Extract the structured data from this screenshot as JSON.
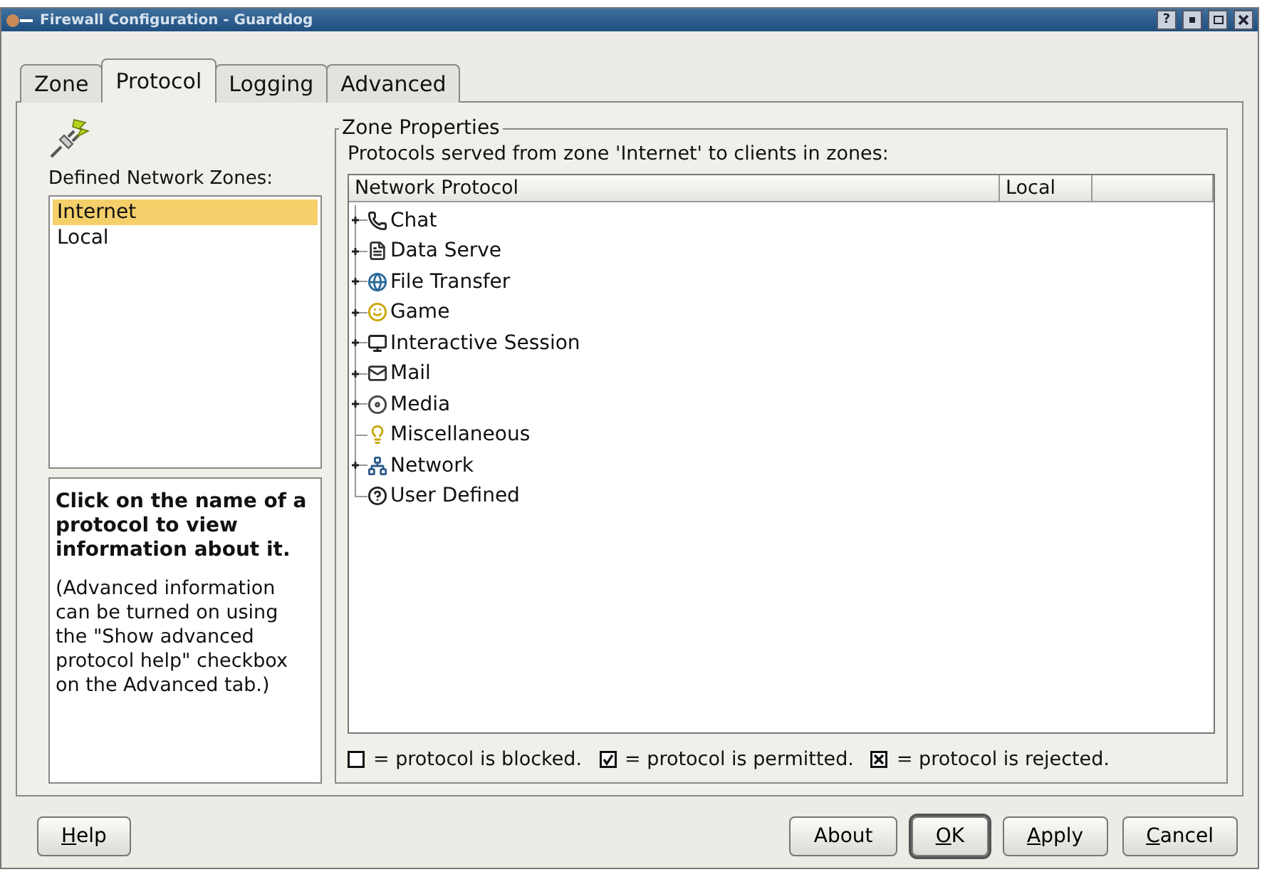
{
  "window": {
    "title": "Firewall Configuration - Guarddog",
    "help_glyph": "?"
  },
  "tabs": [
    {
      "label": "Zone",
      "selected": false
    },
    {
      "label": "Protocol",
      "selected": true
    },
    {
      "label": "Logging",
      "selected": false
    },
    {
      "label": "Advanced",
      "selected": false
    }
  ],
  "zones": {
    "label": "Defined Network Zones:",
    "items": [
      {
        "label": "Internet",
        "selected": true
      },
      {
        "label": "Local",
        "selected": false
      }
    ]
  },
  "help": {
    "heading": "Click on the name of a protocol to view information about it.",
    "body": "(Advanced information can be turned on using the \"Show advanced protocol help\" checkbox on the Advanced tab.)"
  },
  "zone_properties": {
    "title": "Zone Properties",
    "caption": "Protocols served from zone 'Internet' to clients in zones:",
    "columns": [
      "Network Protocol",
      "Local"
    ],
    "protocols": [
      {
        "label": "Chat",
        "expandable": true
      },
      {
        "label": "Data Serve",
        "expandable": true
      },
      {
        "label": "File Transfer",
        "expandable": true
      },
      {
        "label": "Game",
        "expandable": true
      },
      {
        "label": "Interactive Session",
        "expandable": true
      },
      {
        "label": "Mail",
        "expandable": true
      },
      {
        "label": "Media",
        "expandable": true
      },
      {
        "label": "Miscellaneous",
        "expandable": false
      },
      {
        "label": "Network",
        "expandable": true
      },
      {
        "label": "User Defined",
        "expandable": false
      }
    ],
    "legend": [
      {
        "kind": "blocked",
        "text": "= protocol is blocked."
      },
      {
        "kind": "permitted",
        "text": "= protocol is permitted."
      },
      {
        "kind": "rejected",
        "text": "= protocol is rejected."
      }
    ]
  },
  "buttons": [
    {
      "label": "Help",
      "mnemonic": true,
      "default": false
    },
    {
      "label": "About",
      "mnemonic": false,
      "default": false
    },
    {
      "label": "OK",
      "mnemonic": true,
      "default": true
    },
    {
      "label": "Apply",
      "mnemonic": true,
      "default": false
    },
    {
      "label": "Cancel",
      "mnemonic": true,
      "default": false
    }
  ]
}
